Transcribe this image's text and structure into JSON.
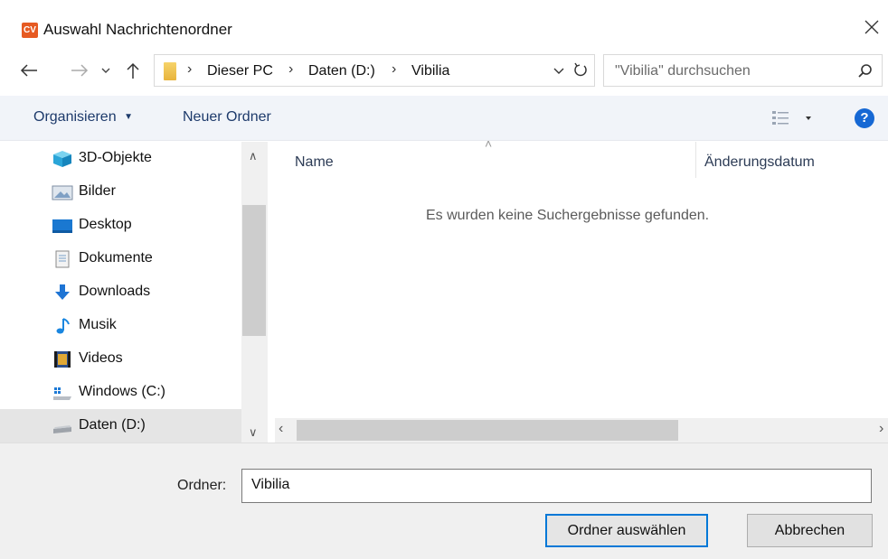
{
  "window": {
    "app_icon_text": "CV",
    "title": "Auswahl Nachrichtenordner"
  },
  "address": {
    "breadcrumbs": [
      "Dieser PC",
      "Daten (D:)",
      "Vibilia"
    ],
    "search_placeholder": "\"Vibilia\" durchsuchen"
  },
  "toolbar": {
    "organize_label": "Organisieren",
    "new_folder_label": "Neuer Ordner",
    "help_label": "?"
  },
  "sidebar": {
    "items": [
      {
        "label": "3D-Objekte",
        "icon": "3d-objects-icon"
      },
      {
        "label": "Bilder",
        "icon": "pictures-icon"
      },
      {
        "label": "Desktop",
        "icon": "desktop-icon"
      },
      {
        "label": "Dokumente",
        "icon": "documents-icon"
      },
      {
        "label": "Downloads",
        "icon": "downloads-icon"
      },
      {
        "label": "Musik",
        "icon": "music-icon"
      },
      {
        "label": "Videos",
        "icon": "videos-icon"
      },
      {
        "label": "Windows (C:)",
        "icon": "windows-drive-icon"
      },
      {
        "label": "Daten (D:)",
        "icon": "drive-icon",
        "selected": true
      }
    ]
  },
  "filelist": {
    "columns": [
      "Name",
      "Änderungsdatum"
    ],
    "empty_message": "Es wurden keine Suchergebnisse gefunden."
  },
  "footer": {
    "folder_label": "Ordner:",
    "folder_value": "Vibilia",
    "select_button": "Ordner auswählen",
    "cancel_button": "Abbrechen"
  },
  "colors": {
    "accent": "#0078d7",
    "toolbar_bg": "#f1f4f9",
    "app_icon": "#e65a22"
  }
}
